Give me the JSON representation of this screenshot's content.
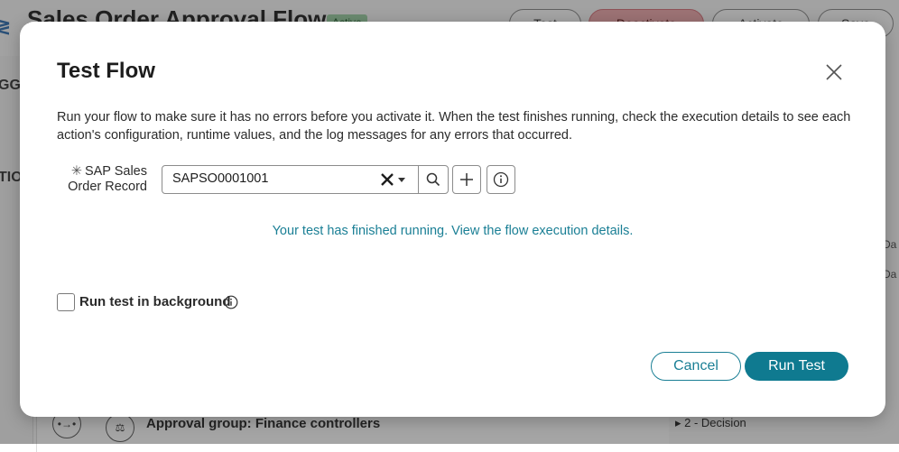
{
  "background": {
    "title": "Sales Order Approval Flow",
    "status_badge": "Active",
    "header_buttons": [
      "Test",
      "Deactivate",
      "Activate",
      "Save"
    ],
    "sidebar_fragments": [
      "GG",
      "TIO"
    ],
    "approval_row": "Approval group: Finance controllers",
    "decision_row": "▸ 2 - Decision",
    "right_fragments": [
      "Da",
      "Da"
    ]
  },
  "modal": {
    "title": "Test Flow",
    "description": "Run your flow to make sure it has no errors before you activate it. When the test finishes running, check the execution details to see each action's configuration, runtime values, and the log messages for any errors that occurred.",
    "record_field": {
      "required_mark": "✳",
      "label": "SAP Sales Order Record",
      "value": "SAPSO0001001"
    },
    "result_message": "Your test has finished running. View the flow execution details.",
    "background_checkbox": {
      "label": "Run test in background",
      "checked": false
    },
    "buttons": {
      "cancel": "Cancel",
      "run": "Run Test"
    }
  },
  "colors": {
    "accent": "#0f7a90",
    "link": "#1a7f95",
    "overlay": "rgba(40,40,40,0.42)"
  },
  "icons": [
    "close-icon",
    "clear-icon",
    "chevron-down-icon",
    "search-icon",
    "plus-icon",
    "info-icon"
  ]
}
